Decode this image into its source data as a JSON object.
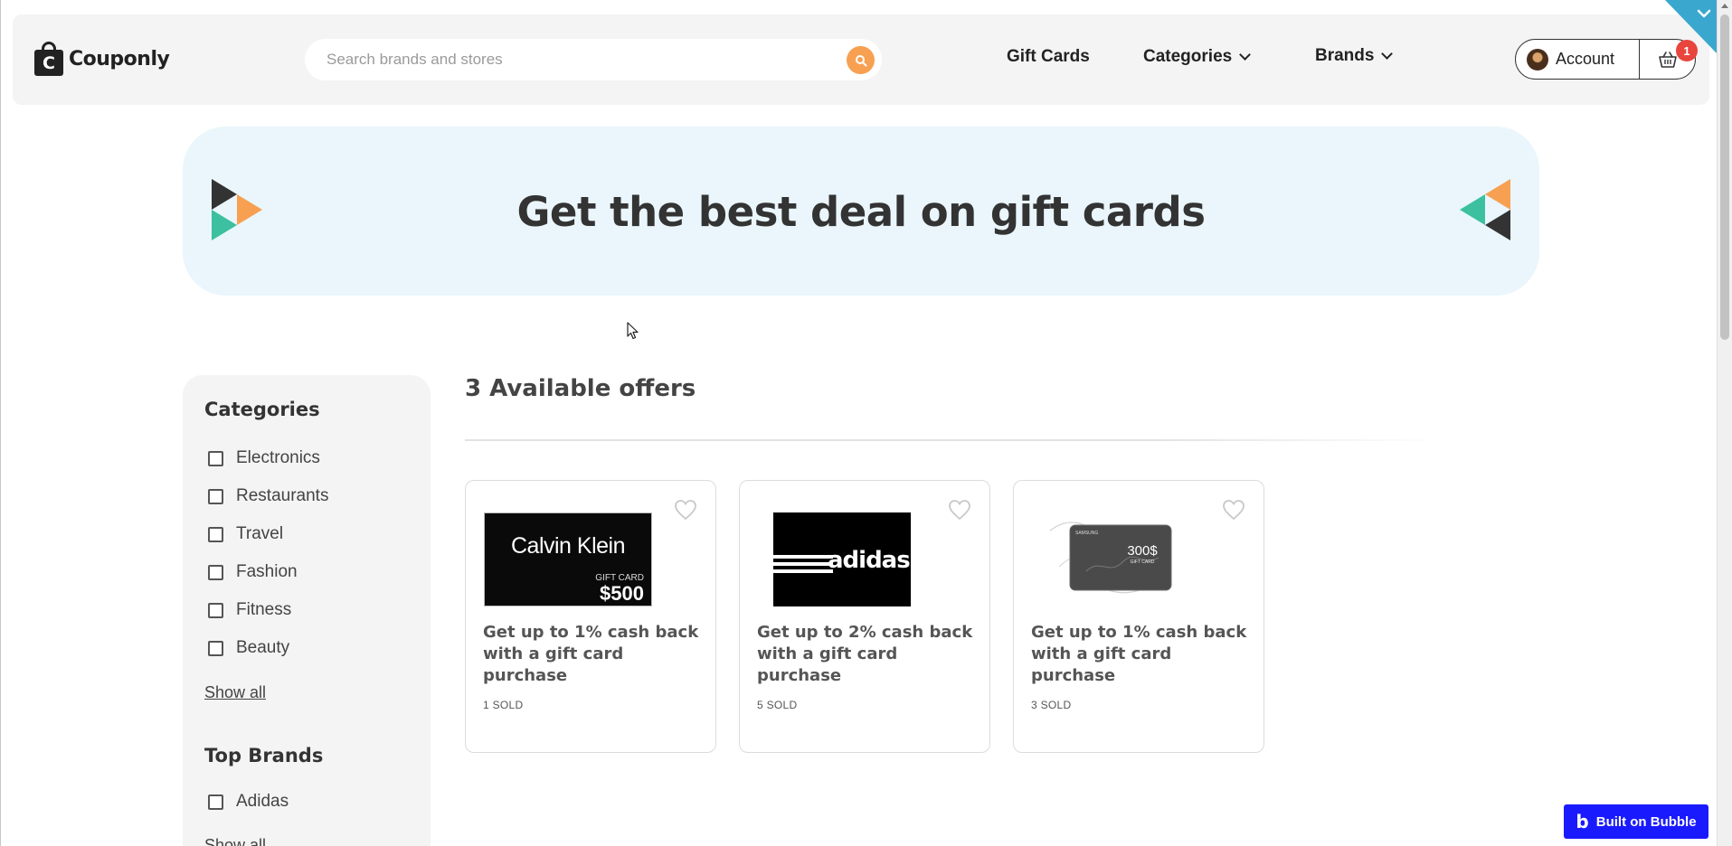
{
  "header": {
    "logo_text": "Couponly",
    "logo_letter": "C",
    "search_placeholder": "Search brands and stores",
    "nav": {
      "gift_cards": "Gift Cards",
      "categories": "Categories",
      "brands": "Brands"
    },
    "account_label": "Account",
    "cart_count": "1"
  },
  "banner": {
    "title": "Get the best deal on gift cards"
  },
  "sidebar": {
    "categories_heading": "Categories",
    "categories": [
      "Electronics",
      "Restaurants",
      "Travel",
      "Fashion",
      "Fitness",
      "Beauty"
    ],
    "show_all": "Show all",
    "top_brands_heading": "Top Brands",
    "brands": [
      "Adidas"
    ],
    "show_all_brands": "Show all"
  },
  "main": {
    "offers_title": "3 Available offers",
    "offers": [
      {
        "title": "Get up to 1% cash back with a gift card purchase",
        "sold": "1 SOLD",
        "image": {
          "brand": "Calvin Klein",
          "label": "GIFT CARD",
          "amount": "$500"
        }
      },
      {
        "title": "Get up to 2% cash back with a gift card purchase",
        "sold": "5 SOLD",
        "image": {
          "brand": "adidas"
        }
      },
      {
        "title": "Get up to 1% cash back with a gift card purchase",
        "sold": "3 SOLD",
        "image": {
          "brand": "SAMSUNG",
          "amount": "300$",
          "label": "GIFT CARD"
        }
      }
    ]
  },
  "footer_badge": {
    "label": "Built on Bubble",
    "logo": "b"
  },
  "colors": {
    "accent_orange": "#f7a052",
    "accent_teal": "#3cc0a0",
    "dark": "#333333",
    "banner_bg": "#eaf6fc",
    "badge_red": "#e8453c",
    "bubble_blue": "#1a1aff"
  },
  "icons": [
    "search-icon",
    "chevron-down-icon",
    "cart-icon",
    "heart-icon",
    "triangle-logo-icon"
  ]
}
